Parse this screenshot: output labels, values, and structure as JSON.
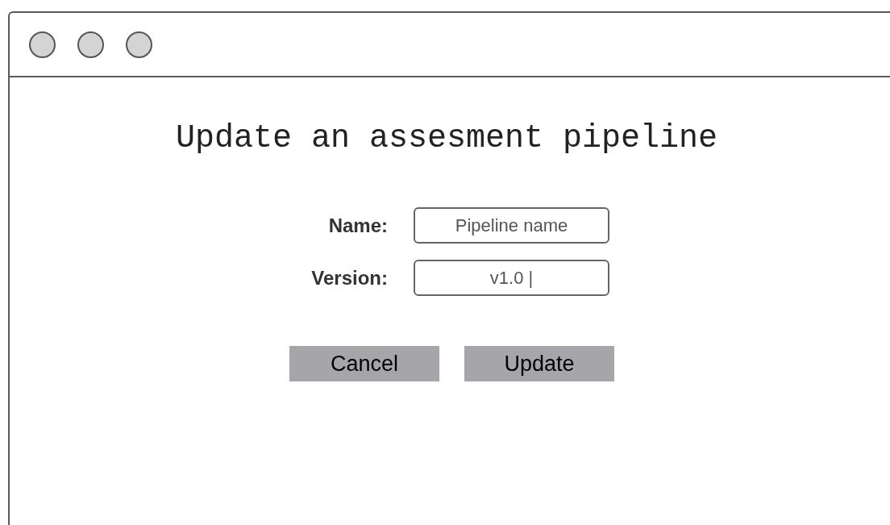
{
  "title": "Update an assesment pipeline",
  "fields": [
    {
      "label": "Name:",
      "placeholder": "Pipeline name"
    },
    {
      "label": "Version:",
      "value": "v1.0 |"
    }
  ],
  "buttons": [
    "Cancel",
    "Update"
  ]
}
